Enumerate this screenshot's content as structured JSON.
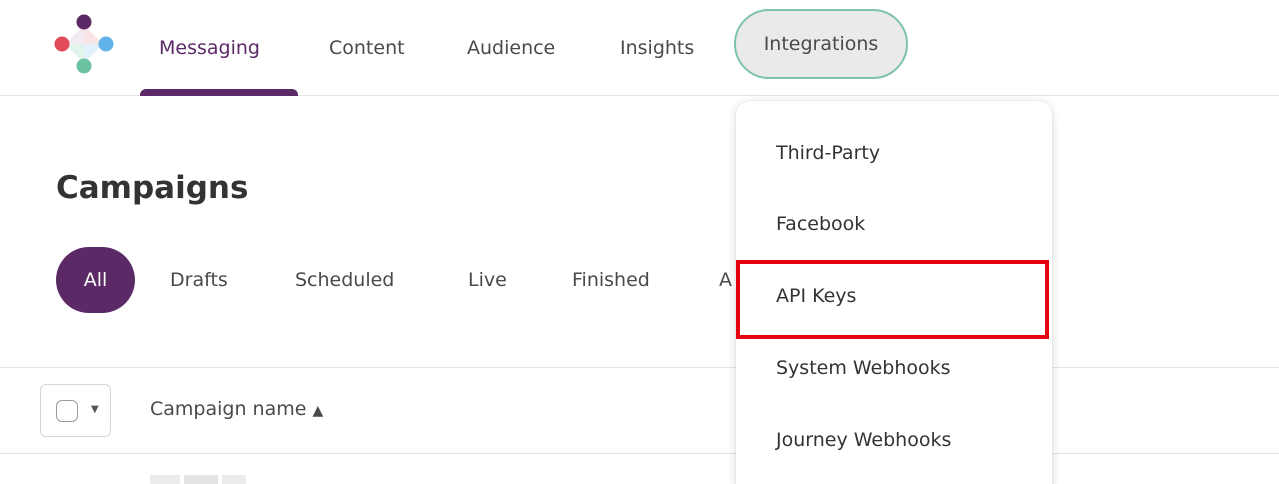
{
  "nav": {
    "items": [
      {
        "label": "Messaging",
        "active": true
      },
      {
        "label": "Content",
        "active": false
      },
      {
        "label": "Audience",
        "active": false
      },
      {
        "label": "Insights",
        "active": false
      },
      {
        "label": "Integrations",
        "active": false,
        "open": true
      }
    ]
  },
  "page": {
    "title": "Campaigns"
  },
  "filters": {
    "tabs": [
      "All",
      "Drafts",
      "Scheduled",
      "Live",
      "Finished",
      "A"
    ],
    "selected": "All"
  },
  "table": {
    "columns": [
      {
        "label": "Campaign name",
        "sortable": true,
        "icon": "sort-icon"
      }
    ]
  },
  "integrations_menu": {
    "items": [
      "Third-Party",
      "Facebook",
      "API Keys",
      "System Webhooks",
      "Journey Webhooks"
    ],
    "highlighted": "API Keys"
  },
  "colors": {
    "brand_purple": "#5b2a66",
    "pill_border_green": "#7dc4a6",
    "highlight_red": "#e60012",
    "logo_dots": [
      "#5b2a66",
      "#e04a5a",
      "#5fb3e8",
      "#6cc3a0"
    ]
  }
}
